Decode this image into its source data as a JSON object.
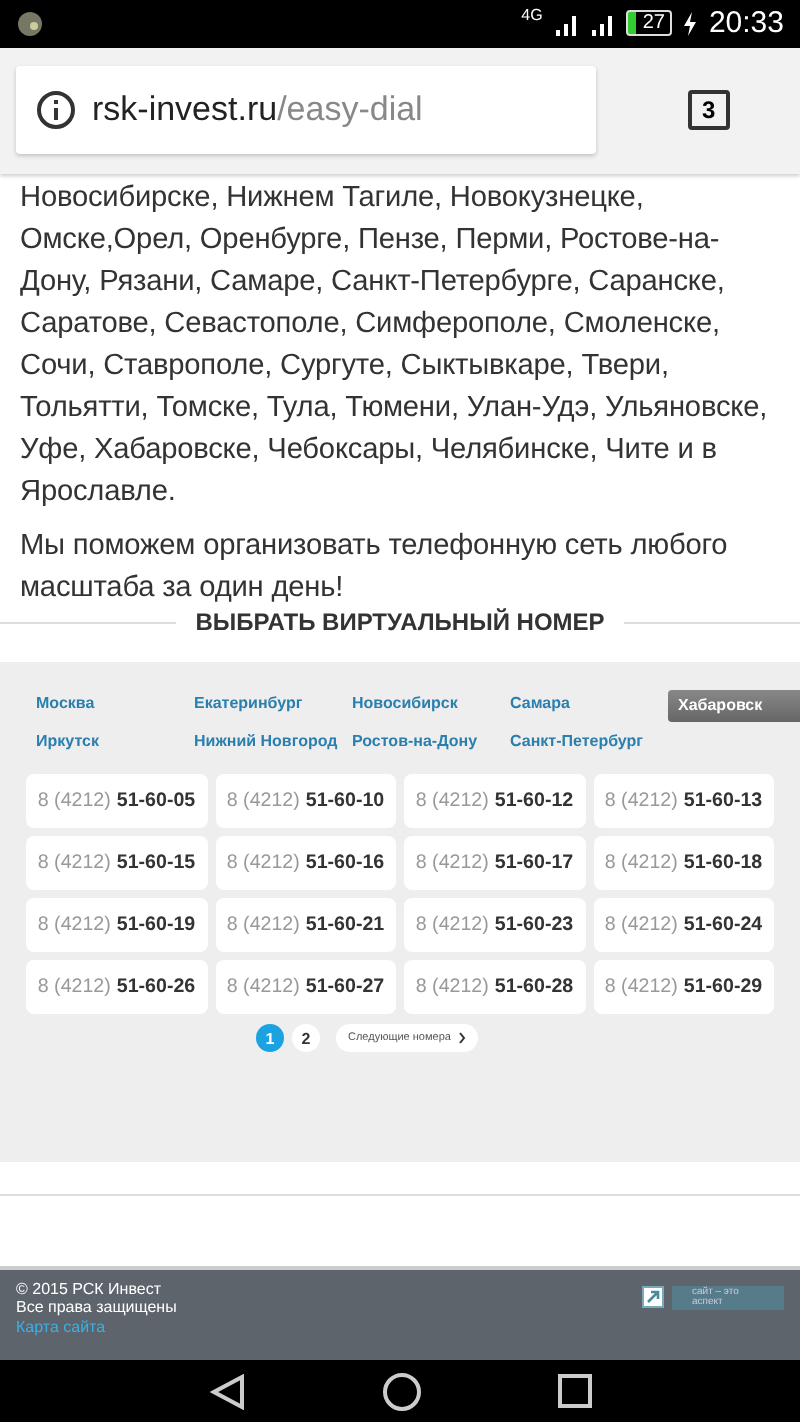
{
  "status_bar": {
    "network": "4G",
    "battery": "27",
    "time": "20:33"
  },
  "browser": {
    "domain": "rsk-invest.ru",
    "path": "/easy-dial",
    "tab_count": "3"
  },
  "article": {
    "paragraphs": [
      "Новосибирске, Нижнем Тагиле, Новокузнецке, Омске,Орел, Оренбурге, Пензе, Перми, Ростове-на-Дону, Рязани, Самаре, Санкт-Петербурге, Саранске, Саратове, Севастополе, Симферополе, Смоленске, Сочи, Ставрополе, Сургуте, Сыктывкаре, Твери, Тольятти, Томске, Тула, Тюмени, Улан-Удэ, Ульяновске, Уфе, Хабаровске, Чебоксары, Челябинске, Чите и в Ярославле.",
      "Мы поможем организовать телефонную сеть любого масштаба за один день!"
    ]
  },
  "picker": {
    "title": "ВЫБРАТЬ ВИРТУАЛЬНЫЙ НОМЕР",
    "cities": [
      {
        "label": "Москва",
        "selected": false
      },
      {
        "label": "Екатеринбург",
        "selected": false
      },
      {
        "label": "Новосибирск",
        "selected": false
      },
      {
        "label": "Самара",
        "selected": false
      },
      {
        "label": "Хабаровск",
        "selected": true
      },
      {
        "label": "Иркутск",
        "selected": false
      },
      {
        "label": "Нижний Новгород",
        "selected": false
      },
      {
        "label": "Ростов-на-Дону",
        "selected": false
      },
      {
        "label": "Санкт-Петербург",
        "selected": false
      }
    ],
    "numbers": [
      {
        "prefix": "8 (4212)",
        "number": "51-60-05"
      },
      {
        "prefix": "8 (4212)",
        "number": "51-60-10"
      },
      {
        "prefix": "8 (4212)",
        "number": "51-60-12"
      },
      {
        "prefix": "8 (4212)",
        "number": "51-60-13"
      },
      {
        "prefix": "8 (4212)",
        "number": "51-60-15"
      },
      {
        "prefix": "8 (4212)",
        "number": "51-60-16"
      },
      {
        "prefix": "8 (4212)",
        "number": "51-60-17"
      },
      {
        "prefix": "8 (4212)",
        "number": "51-60-18"
      },
      {
        "prefix": "8 (4212)",
        "number": "51-60-19"
      },
      {
        "prefix": "8 (4212)",
        "number": "51-60-21"
      },
      {
        "prefix": "8 (4212)",
        "number": "51-60-23"
      },
      {
        "prefix": "8 (4212)",
        "number": "51-60-24"
      },
      {
        "prefix": "8 (4212)",
        "number": "51-60-26"
      },
      {
        "prefix": "8 (4212)",
        "number": "51-60-27"
      },
      {
        "prefix": "8 (4212)",
        "number": "51-60-28"
      },
      {
        "prefix": "8 (4212)",
        "number": "51-60-29"
      }
    ],
    "pages": [
      {
        "label": "1",
        "selected": true
      },
      {
        "label": "2",
        "selected": false
      }
    ],
    "next": "Следующие номера"
  },
  "footer": {
    "copyright": "© 2015 РСК Инвест",
    "rights": "Все права защищены",
    "sitemap": "Карта сайта",
    "badge": [
      "сайт – это",
      "аспект"
    ]
  }
}
